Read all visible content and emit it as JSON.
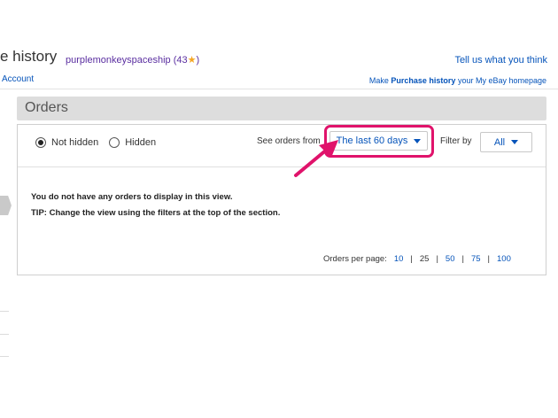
{
  "header": {
    "title": "e history",
    "username": "purplemonkeyspaceship",
    "feedback_score": "(43",
    "feedback_close": ")",
    "star_icon": "star-icon",
    "tell_us": "Tell us what you think",
    "account_link": "Account",
    "homepage_prefix": "Make ",
    "homepage_bold": "Purchase history",
    "homepage_suffix": " your My eBay homepage"
  },
  "orders": {
    "section_title": "Orders",
    "radio_not_hidden": "Not hidden",
    "radio_hidden": "Hidden",
    "selected_radio": "Not hidden",
    "see_orders_label": "See orders from",
    "period_value": "The last 60 days",
    "filter_label": "Filter by",
    "filter_value": "All",
    "empty_message": "You do not have any orders to display in this view.",
    "tip_message": "TIP: Change the view using the filters at the top of the section.",
    "per_page_label": "Orders per page:",
    "per_page_options": [
      "10",
      "25",
      "50",
      "75",
      "100"
    ],
    "per_page_current": "25"
  },
  "colors": {
    "highlight": "#e0136b",
    "link": "#0654ba",
    "username": "#5a2ea0"
  }
}
